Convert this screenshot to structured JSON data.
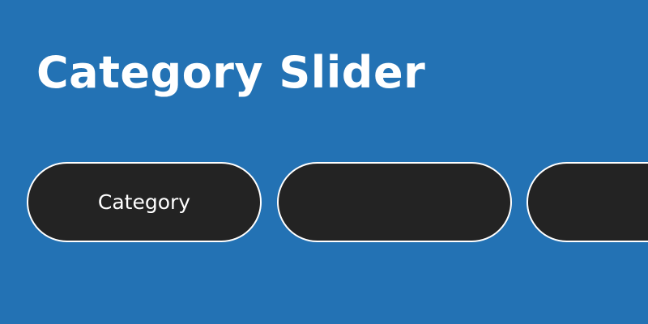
{
  "page": {
    "title": "Category Slider",
    "background_color": "#2372b4"
  },
  "slider": {
    "pill_color": "#232323",
    "pill_border_color": "#ffffff",
    "items": [
      {
        "label": "Category"
      },
      {
        "label": ""
      },
      {
        "label": ""
      }
    ]
  }
}
